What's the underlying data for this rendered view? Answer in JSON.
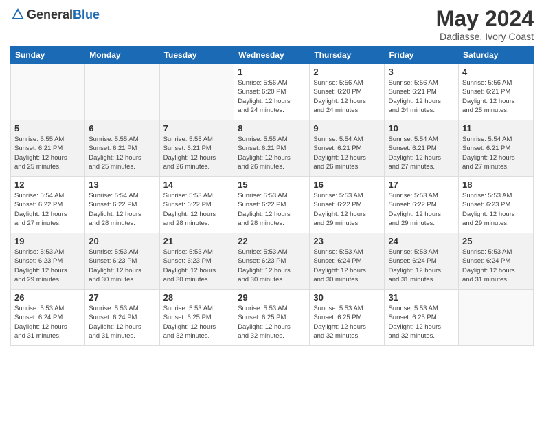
{
  "header": {
    "logo_general": "General",
    "logo_blue": "Blue",
    "month_title": "May 2024",
    "location": "Dadiasse, Ivory Coast"
  },
  "weekdays": [
    "Sunday",
    "Monday",
    "Tuesday",
    "Wednesday",
    "Thursday",
    "Friday",
    "Saturday"
  ],
  "weeks": [
    {
      "days": [
        {
          "num": "",
          "info": ""
        },
        {
          "num": "",
          "info": ""
        },
        {
          "num": "",
          "info": ""
        },
        {
          "num": "1",
          "info": "Sunrise: 5:56 AM\nSunset: 6:20 PM\nDaylight: 12 hours\nand 24 minutes."
        },
        {
          "num": "2",
          "info": "Sunrise: 5:56 AM\nSunset: 6:20 PM\nDaylight: 12 hours\nand 24 minutes."
        },
        {
          "num": "3",
          "info": "Sunrise: 5:56 AM\nSunset: 6:21 PM\nDaylight: 12 hours\nand 24 minutes."
        },
        {
          "num": "4",
          "info": "Sunrise: 5:56 AM\nSunset: 6:21 PM\nDaylight: 12 hours\nand 25 minutes."
        }
      ]
    },
    {
      "days": [
        {
          "num": "5",
          "info": "Sunrise: 5:55 AM\nSunset: 6:21 PM\nDaylight: 12 hours\nand 25 minutes."
        },
        {
          "num": "6",
          "info": "Sunrise: 5:55 AM\nSunset: 6:21 PM\nDaylight: 12 hours\nand 25 minutes."
        },
        {
          "num": "7",
          "info": "Sunrise: 5:55 AM\nSunset: 6:21 PM\nDaylight: 12 hours\nand 26 minutes."
        },
        {
          "num": "8",
          "info": "Sunrise: 5:55 AM\nSunset: 6:21 PM\nDaylight: 12 hours\nand 26 minutes."
        },
        {
          "num": "9",
          "info": "Sunrise: 5:54 AM\nSunset: 6:21 PM\nDaylight: 12 hours\nand 26 minutes."
        },
        {
          "num": "10",
          "info": "Sunrise: 5:54 AM\nSunset: 6:21 PM\nDaylight: 12 hours\nand 27 minutes."
        },
        {
          "num": "11",
          "info": "Sunrise: 5:54 AM\nSunset: 6:21 PM\nDaylight: 12 hours\nand 27 minutes."
        }
      ]
    },
    {
      "days": [
        {
          "num": "12",
          "info": "Sunrise: 5:54 AM\nSunset: 6:22 PM\nDaylight: 12 hours\nand 27 minutes."
        },
        {
          "num": "13",
          "info": "Sunrise: 5:54 AM\nSunset: 6:22 PM\nDaylight: 12 hours\nand 28 minutes."
        },
        {
          "num": "14",
          "info": "Sunrise: 5:53 AM\nSunset: 6:22 PM\nDaylight: 12 hours\nand 28 minutes."
        },
        {
          "num": "15",
          "info": "Sunrise: 5:53 AM\nSunset: 6:22 PM\nDaylight: 12 hours\nand 28 minutes."
        },
        {
          "num": "16",
          "info": "Sunrise: 5:53 AM\nSunset: 6:22 PM\nDaylight: 12 hours\nand 29 minutes."
        },
        {
          "num": "17",
          "info": "Sunrise: 5:53 AM\nSunset: 6:22 PM\nDaylight: 12 hours\nand 29 minutes."
        },
        {
          "num": "18",
          "info": "Sunrise: 5:53 AM\nSunset: 6:23 PM\nDaylight: 12 hours\nand 29 minutes."
        }
      ]
    },
    {
      "days": [
        {
          "num": "19",
          "info": "Sunrise: 5:53 AM\nSunset: 6:23 PM\nDaylight: 12 hours\nand 29 minutes."
        },
        {
          "num": "20",
          "info": "Sunrise: 5:53 AM\nSunset: 6:23 PM\nDaylight: 12 hours\nand 30 minutes."
        },
        {
          "num": "21",
          "info": "Sunrise: 5:53 AM\nSunset: 6:23 PM\nDaylight: 12 hours\nand 30 minutes."
        },
        {
          "num": "22",
          "info": "Sunrise: 5:53 AM\nSunset: 6:23 PM\nDaylight: 12 hours\nand 30 minutes."
        },
        {
          "num": "23",
          "info": "Sunrise: 5:53 AM\nSunset: 6:24 PM\nDaylight: 12 hours\nand 30 minutes."
        },
        {
          "num": "24",
          "info": "Sunrise: 5:53 AM\nSunset: 6:24 PM\nDaylight: 12 hours\nand 31 minutes."
        },
        {
          "num": "25",
          "info": "Sunrise: 5:53 AM\nSunset: 6:24 PM\nDaylight: 12 hours\nand 31 minutes."
        }
      ]
    },
    {
      "days": [
        {
          "num": "26",
          "info": "Sunrise: 5:53 AM\nSunset: 6:24 PM\nDaylight: 12 hours\nand 31 minutes."
        },
        {
          "num": "27",
          "info": "Sunrise: 5:53 AM\nSunset: 6:24 PM\nDaylight: 12 hours\nand 31 minutes."
        },
        {
          "num": "28",
          "info": "Sunrise: 5:53 AM\nSunset: 6:25 PM\nDaylight: 12 hours\nand 32 minutes."
        },
        {
          "num": "29",
          "info": "Sunrise: 5:53 AM\nSunset: 6:25 PM\nDaylight: 12 hours\nand 32 minutes."
        },
        {
          "num": "30",
          "info": "Sunrise: 5:53 AM\nSunset: 6:25 PM\nDaylight: 12 hours\nand 32 minutes."
        },
        {
          "num": "31",
          "info": "Sunrise: 5:53 AM\nSunset: 6:25 PM\nDaylight: 12 hours\nand 32 minutes."
        },
        {
          "num": "",
          "info": ""
        }
      ]
    }
  ]
}
